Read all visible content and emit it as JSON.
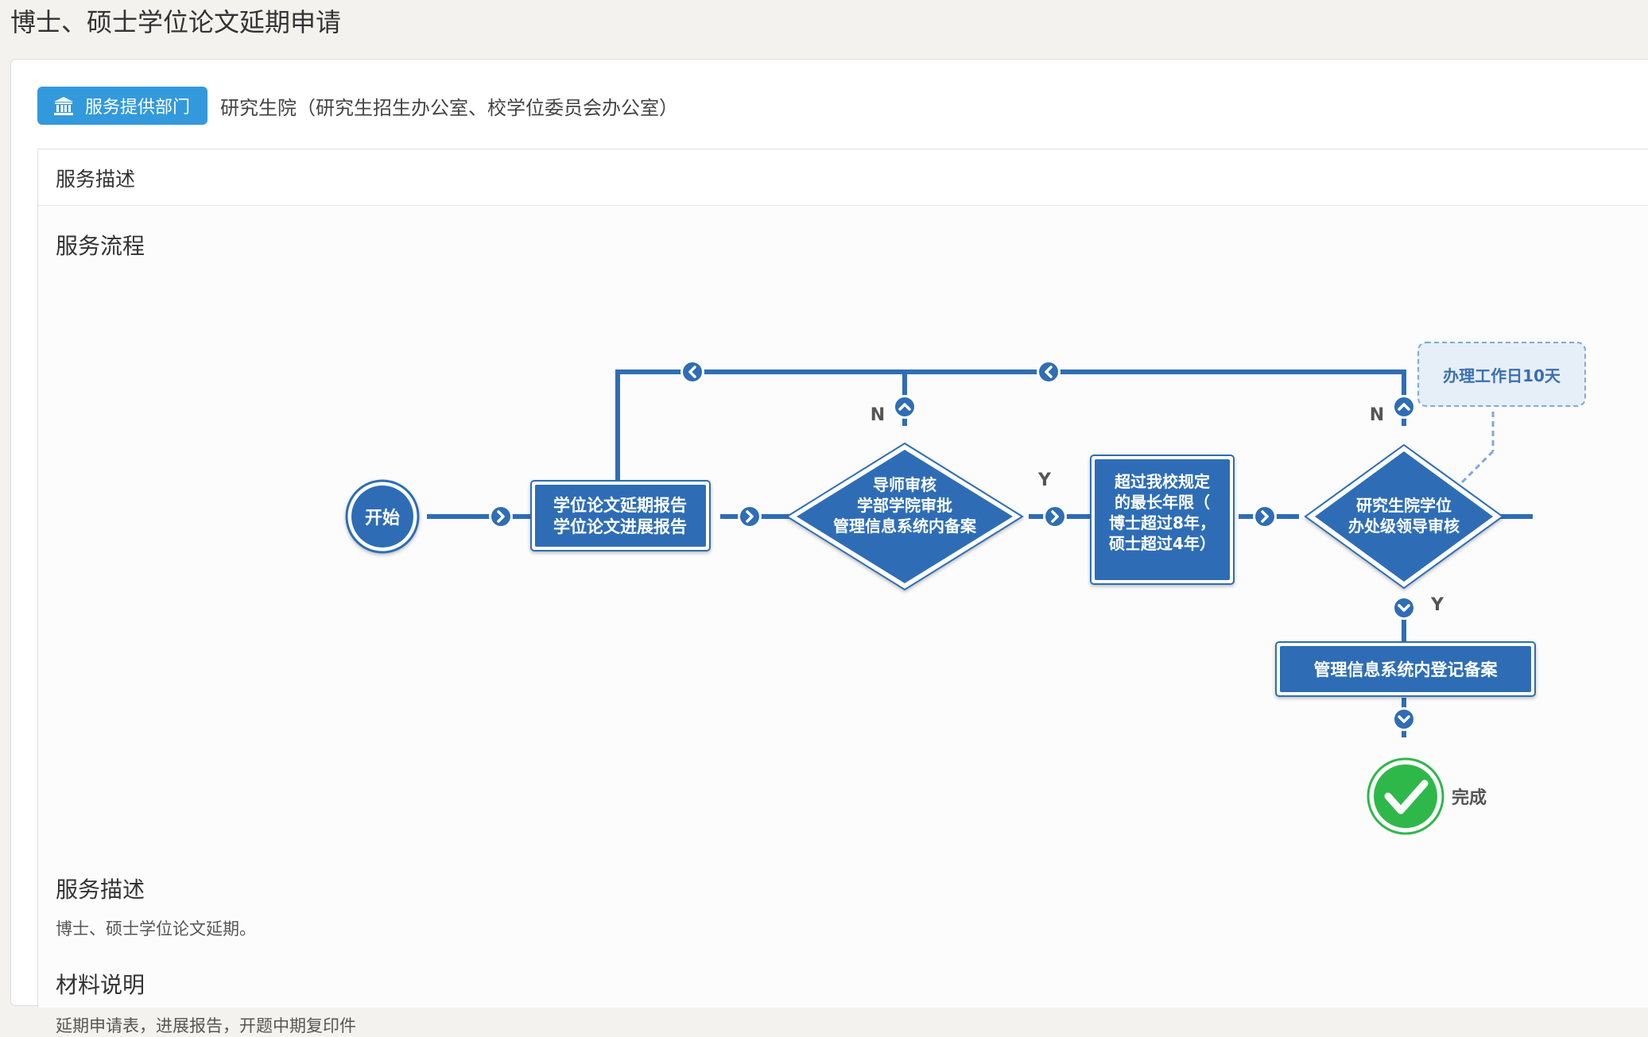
{
  "page": {
    "title": "博士、硕士学位论文延期申请"
  },
  "department": {
    "badge_label": "服务提供部门",
    "badge_icon": "bank-icon",
    "name": "研究生院（研究生招生办公室、校学位委员会办公室）"
  },
  "service": {
    "header": "服务描述",
    "flow_title": "服务流程",
    "desc_title": "服务描述",
    "desc_text": "博士、硕士学位论文延期。",
    "materials_title": "材料说明",
    "materials_text": "延期申请表，进展报告，开题中期复印件"
  },
  "flow": {
    "start": "开始",
    "step1_line1": "学位论文延期报告",
    "step1_line2": "学位论文进展报告",
    "decision1_line1": "导师审核",
    "decision1_line2": "学部学院审批",
    "decision1_line3": "管理信息系统内备案",
    "step2_line1": "超过我校规定",
    "step2_line2": "的最长年限（",
    "step2_line3": "博士超过8年，",
    "step2_line4": "硕士超过4年）",
    "decision2_line1": "研究生院学位",
    "decision2_line2": "办处级领导审核",
    "step3": "管理信息系统内登记备案",
    "note": "办理工作日10天",
    "done": "完成",
    "label_n1": "N",
    "label_n2": "N",
    "label_y1": "Y",
    "label_y2": "Y"
  },
  "colors": {
    "primary": "#2f6db5",
    "badge": "#3399dd",
    "done": "#2fb84a"
  }
}
